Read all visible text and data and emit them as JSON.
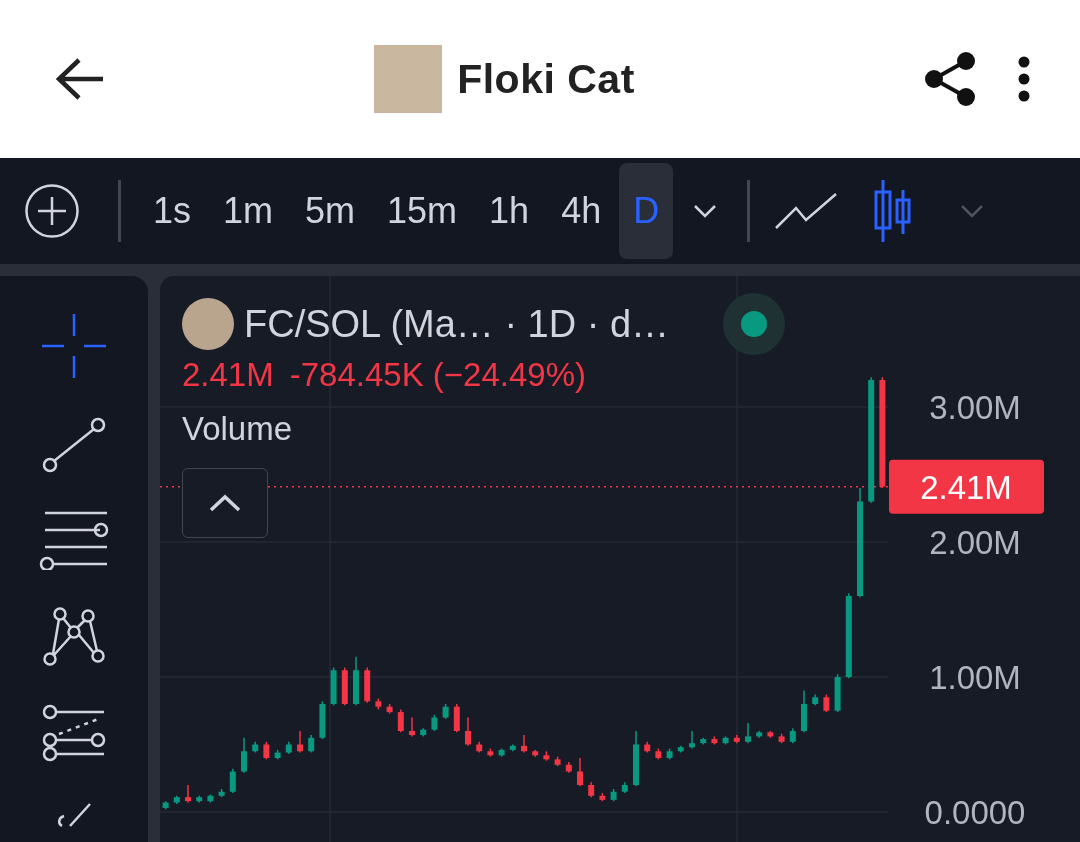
{
  "header": {
    "title": "Floki Cat"
  },
  "intervals": [
    {
      "label": "1s",
      "selected": false
    },
    {
      "label": "1m",
      "selected": false
    },
    {
      "label": "5m",
      "selected": false
    },
    {
      "label": "15m",
      "selected": false
    },
    {
      "label": "1h",
      "selected": false
    },
    {
      "label": "4h",
      "selected": false
    },
    {
      "label": "D",
      "selected": true
    }
  ],
  "chart_types": [
    {
      "kind": "line",
      "selected": false
    },
    {
      "kind": "candles",
      "selected": true
    }
  ],
  "tools": [
    {
      "kind": "crosshair",
      "selected": true
    },
    {
      "kind": "trend-line",
      "selected": false
    },
    {
      "kind": "fib",
      "selected": false
    },
    {
      "kind": "pattern",
      "selected": false
    },
    {
      "kind": "projection",
      "selected": false
    },
    {
      "kind": "brush",
      "selected": false
    }
  ],
  "legend": {
    "symbol": "FC/SOL (Ma… · 1D · d…",
    "price": "2.41M",
    "change": "-784.45K (−24.49%)",
    "indicator": "Volume"
  },
  "chart_data": {
    "type": "candlestick",
    "grid": true,
    "ref_lines": [
      {
        "axis": "y",
        "value": 2.41,
        "label": "2.41M",
        "color": "#f23645"
      }
    ],
    "categories": [
      null,
      null,
      null,
      null,
      null,
      null,
      null,
      null,
      null,
      null,
      null,
      null,
      null,
      null,
      null,
      null,
      null,
      null,
      null,
      null,
      null,
      null,
      null,
      null,
      null,
      null,
      null,
      null,
      null,
      null,
      null,
      null,
      null,
      null,
      null,
      null,
      null,
      null,
      null,
      null,
      null,
      null,
      null,
      null,
      null,
      null,
      null,
      null,
      null,
      null,
      null,
      null,
      null,
      null,
      null,
      null,
      null,
      null,
      null,
      null,
      null,
      null,
      null,
      null,
      null
    ],
    "ohlc": [
      [
        0.03,
        0.08,
        0.02,
        0.07
      ],
      [
        0.07,
        0.12,
        0.06,
        0.11
      ],
      [
        0.11,
        0.2,
        0.07,
        0.08
      ],
      [
        0.08,
        0.12,
        0.07,
        0.11
      ],
      [
        0.08,
        0.13,
        0.07,
        0.12
      ],
      [
        0.12,
        0.17,
        0.11,
        0.15
      ],
      [
        0.15,
        0.32,
        0.14,
        0.3
      ],
      [
        0.3,
        0.55,
        0.29,
        0.45
      ],
      [
        0.45,
        0.52,
        0.44,
        0.5
      ],
      [
        0.5,
        0.52,
        0.39,
        0.4
      ],
      [
        0.4,
        0.46,
        0.39,
        0.44
      ],
      [
        0.44,
        0.52,
        0.43,
        0.5
      ],
      [
        0.5,
        0.6,
        0.44,
        0.45
      ],
      [
        0.45,
        0.57,
        0.44,
        0.55
      ],
      [
        0.55,
        0.82,
        0.54,
        0.8
      ],
      [
        0.8,
        1.07,
        0.79,
        1.05
      ],
      [
        1.05,
        1.07,
        0.79,
        0.8
      ],
      [
        0.8,
        1.15,
        0.79,
        1.05
      ],
      [
        1.05,
        1.07,
        0.81,
        0.82
      ],
      [
        0.82,
        0.84,
        0.76,
        0.78
      ],
      [
        0.78,
        0.8,
        0.73,
        0.74
      ],
      [
        0.74,
        0.76,
        0.59,
        0.6
      ],
      [
        0.6,
        0.7,
        0.56,
        0.57
      ],
      [
        0.57,
        0.62,
        0.56,
        0.61
      ],
      [
        0.61,
        0.72,
        0.6,
        0.7
      ],
      [
        0.7,
        0.8,
        0.69,
        0.78
      ],
      [
        0.78,
        0.8,
        0.59,
        0.6
      ],
      [
        0.6,
        0.7,
        0.49,
        0.5
      ],
      [
        0.5,
        0.52,
        0.44,
        0.45
      ],
      [
        0.45,
        0.47,
        0.41,
        0.42
      ],
      [
        0.42,
        0.47,
        0.41,
        0.46
      ],
      [
        0.46,
        0.5,
        0.45,
        0.49
      ],
      [
        0.49,
        0.57,
        0.44,
        0.45
      ],
      [
        0.45,
        0.46,
        0.41,
        0.42
      ],
      [
        0.42,
        0.45,
        0.38,
        0.39
      ],
      [
        0.39,
        0.41,
        0.34,
        0.35
      ],
      [
        0.35,
        0.37,
        0.29,
        0.3
      ],
      [
        0.3,
        0.4,
        0.19,
        0.2
      ],
      [
        0.2,
        0.22,
        0.11,
        0.12
      ],
      [
        0.12,
        0.14,
        0.08,
        0.09
      ],
      [
        0.09,
        0.17,
        0.08,
        0.15
      ],
      [
        0.15,
        0.22,
        0.14,
        0.2
      ],
      [
        0.2,
        0.6,
        0.19,
        0.5
      ],
      [
        0.5,
        0.52,
        0.44,
        0.45
      ],
      [
        0.45,
        0.47,
        0.39,
        0.4
      ],
      [
        0.4,
        0.47,
        0.39,
        0.45
      ],
      [
        0.45,
        0.49,
        0.44,
        0.48
      ],
      [
        0.48,
        0.6,
        0.47,
        0.51
      ],
      [
        0.51,
        0.55,
        0.5,
        0.54
      ],
      [
        0.54,
        0.56,
        0.5,
        0.51
      ],
      [
        0.51,
        0.56,
        0.5,
        0.55
      ],
      [
        0.55,
        0.57,
        0.51,
        0.52
      ],
      [
        0.52,
        0.66,
        0.51,
        0.56
      ],
      [
        0.56,
        0.6,
        0.55,
        0.59
      ],
      [
        0.59,
        0.6,
        0.55,
        0.56
      ],
      [
        0.56,
        0.58,
        0.51,
        0.52
      ],
      [
        0.52,
        0.62,
        0.51,
        0.6
      ],
      [
        0.6,
        0.9,
        0.59,
        0.8
      ],
      [
        0.8,
        0.87,
        0.79,
        0.85
      ],
      [
        0.85,
        0.87,
        0.74,
        0.75
      ],
      [
        0.75,
        1.02,
        0.74,
        1.0
      ],
      [
        1.0,
        1.62,
        0.99,
        1.6
      ],
      [
        1.6,
        2.4,
        1.59,
        2.3
      ],
      [
        2.3,
        3.22,
        2.29,
        3.2
      ],
      [
        3.2,
        3.22,
        2.4,
        2.41
      ]
    ],
    "ylim": [
      0,
      3
    ],
    "yticks": [
      {
        "value": 3,
        "label": "3.00M"
      },
      {
        "value": 2,
        "label": "2.00M"
      },
      {
        "value": 1,
        "label": "1.00M"
      },
      {
        "value": 0,
        "label": "0.0000"
      }
    ]
  }
}
